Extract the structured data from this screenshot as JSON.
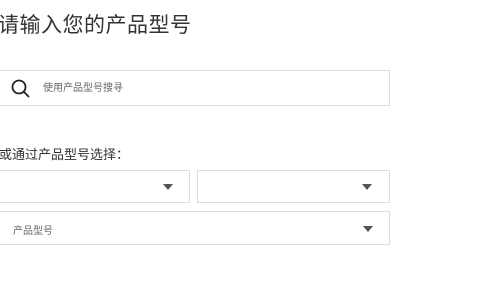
{
  "heading": "请输入您的产品型号",
  "search": {
    "placeholder": "使用产品型号搜寻",
    "value": "",
    "icon": "search-icon"
  },
  "select_section": {
    "label": "或通过产品型号选择：",
    "selects": [
      {
        "value": "",
        "icon": "caret-down-icon"
      },
      {
        "value": "",
        "icon": "caret-down-icon"
      },
      {
        "value": "产品型号",
        "icon": "caret-down-icon"
      }
    ]
  },
  "colors": {
    "border": "#dddddd",
    "text": "#333333",
    "muted_text": "#666666",
    "caret": "#555555"
  }
}
